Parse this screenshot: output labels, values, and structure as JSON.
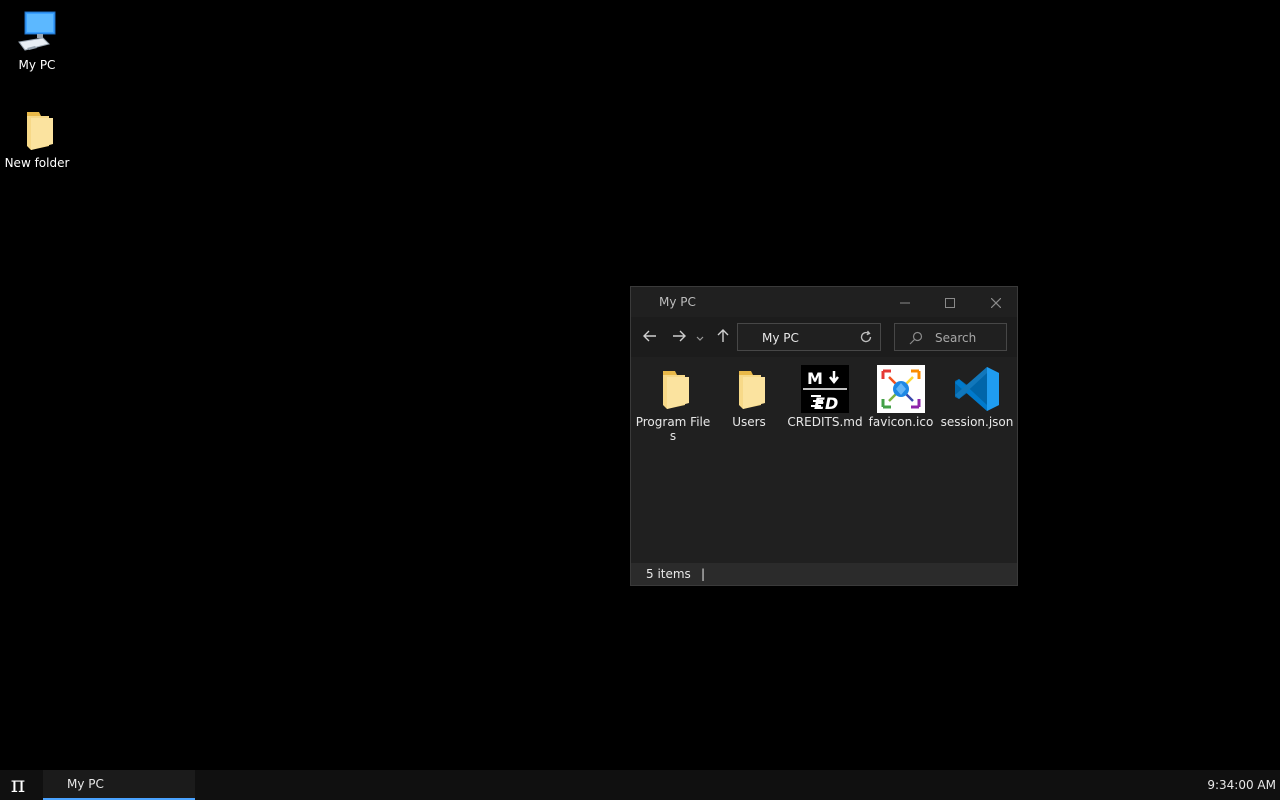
{
  "desktop": {
    "icons": [
      {
        "label": "My PC",
        "icon": "computer-icon"
      },
      {
        "label": "New folder",
        "icon": "folder-icon"
      }
    ]
  },
  "window": {
    "title": "My PC",
    "controls": {
      "minimize": "minimize-icon",
      "maximize": "maximize-icon",
      "close": "close-icon"
    },
    "address": "My PC",
    "search_placeholder": "Search",
    "files": [
      {
        "name": "Program Files",
        "icon": "folder-icon"
      },
      {
        "name": "Users",
        "icon": "folder-icon"
      },
      {
        "name": "CREDITS.md",
        "icon": "markdown-file-icon"
      },
      {
        "name": "favicon.ico",
        "icon": "image-file-icon"
      },
      {
        "name": "session.json",
        "icon": "vscode-file-icon"
      }
    ],
    "status": {
      "count": "5 items",
      "separator": "|"
    }
  },
  "taskbar": {
    "start_glyph": "π",
    "items": [
      {
        "label": "My PC"
      }
    ],
    "clock": "9:34:00 AM"
  },
  "colors": {
    "desktop_bg": "#000000",
    "window_bg": "#202020",
    "accent": "#4aa3ff",
    "folder": "#f3d27a"
  }
}
